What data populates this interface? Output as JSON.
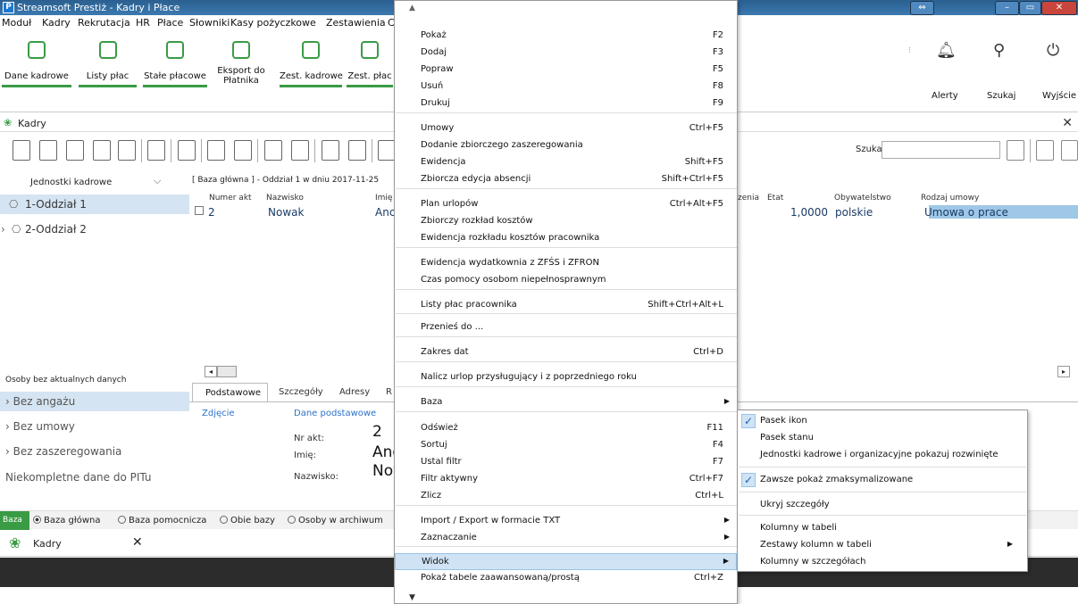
{
  "window": {
    "title": "Streamsoft Prestiż - Kadry i Płace",
    "app_icon": "P"
  },
  "menubar": [
    "Moduł",
    "Kadry",
    "Rekrutacja",
    "HR",
    "Płace",
    "Słowniki",
    "Kasy pożyczkowe",
    "Zestawienia",
    "C"
  ],
  "ribbon": {
    "buttons": [
      "Dane kadrowe",
      "Listy płac",
      "Stałe płacowe",
      "Eksport do Płatnika",
      "Zest. kadrowe",
      "Zest. płac"
    ],
    "right_buttons": [
      "Alerty",
      "Szukaj",
      "Wyjście"
    ]
  },
  "module": {
    "title": "Kadry",
    "search_label": "Szukaj",
    "search_value": ""
  },
  "left_panel": {
    "header": "Jednostki kadrowe",
    "tree": [
      "1-Oddział 1",
      "2-Oddział 2"
    ],
    "section_header": "Osoby bez aktualnych danych",
    "nav": [
      "Bez angażu",
      "Bez umowy",
      "Bez zaszeregowania",
      "Niekompletne dane do PITu"
    ]
  },
  "grid": {
    "caption": "[ Baza główna ] - Oddział 1  w dniu 2017-11-25",
    "columns": [
      "Numer akt",
      "Nazwisko",
      "Imię",
      "zenia",
      "Etat",
      "Obywatelstwo",
      "Rodzaj umowy"
    ],
    "row": [
      "2",
      "Nowak",
      "Anc",
      "1,0000",
      "polskie",
      "Umowa o prace"
    ]
  },
  "detail_tabs": [
    "Podstawowe",
    "Szczegóły",
    "Adresy",
    "R"
  ],
  "details": {
    "photo_link": "Zdjęcie",
    "section_link": "Dane podstawowe",
    "fields": [
      {
        "label": "Nr akt:",
        "value": "2"
      },
      {
        "label": "Imię:",
        "value": "Anc"
      },
      {
        "label": "Nazwisko:",
        "value": "Nov"
      }
    ]
  },
  "statusbar": {
    "label": "Baza",
    "options": [
      "Baza główna",
      "Baza pomocnicza",
      "Obie bazy",
      "Osoby w archiwum"
    ],
    "selected": "Baza główna"
  },
  "taskbar": {
    "tab": "Kadry"
  },
  "context_menu": {
    "items": [
      {
        "label": "Pokaż",
        "shortcut": "F2"
      },
      {
        "label": "Dodaj",
        "shortcut": "F3"
      },
      {
        "label": "Popraw",
        "shortcut": "F5"
      },
      {
        "label": "Usuń",
        "shortcut": "F8"
      },
      {
        "label": "Drukuj",
        "shortcut": "F9"
      },
      {
        "label": "Umowy",
        "shortcut": "Ctrl+F5"
      },
      {
        "label": "Dodanie zbiorczego zaszeregowania",
        "shortcut": ""
      },
      {
        "label": "Ewidencja",
        "shortcut": "Shift+F5"
      },
      {
        "label": "Zbiorcza edycja absencji",
        "shortcut": "Shift+Ctrl+F5"
      },
      {
        "label": "Plan urlopów",
        "shortcut": "Ctrl+Alt+F5"
      },
      {
        "label": "Zbiorczy rozkład kosztów",
        "shortcut": ""
      },
      {
        "label": "Ewidencja rozkładu kosztów pracownika",
        "shortcut": ""
      },
      {
        "label": "Ewidencja wydatkownia z ZFŚS i ZFRON",
        "shortcut": ""
      },
      {
        "label": "Czas pomocy osobom niepełnosprawnym",
        "shortcut": ""
      },
      {
        "label": "Listy płac pracownika",
        "shortcut": "Shift+Ctrl+Alt+L"
      },
      {
        "label": "Przenieś do ...",
        "shortcut": ""
      },
      {
        "label": "Zakres dat",
        "shortcut": "Ctrl+D"
      },
      {
        "label": "Nalicz urlop przysługujący i z poprzedniego roku",
        "shortcut": ""
      },
      {
        "label": "Baza",
        "shortcut": ""
      },
      {
        "label": "Odśwież",
        "shortcut": "F11"
      },
      {
        "label": "Sortuj",
        "shortcut": "F4"
      },
      {
        "label": "Ustal filtr",
        "shortcut": "F7"
      },
      {
        "label": "Filtr aktywny",
        "shortcut": "Ctrl+F7"
      },
      {
        "label": "Zlicz",
        "shortcut": "Ctrl+L"
      },
      {
        "label": "Import / Export w formacie TXT",
        "shortcut": ""
      },
      {
        "label": "Zaznaczanie",
        "shortcut": ""
      },
      {
        "label": "Widok",
        "shortcut": ""
      },
      {
        "label": "Pokaż tabele zaawansowaną/prostą",
        "shortcut": "Ctrl+Z"
      }
    ]
  },
  "submenu": {
    "items": [
      {
        "label": "Pasek ikon",
        "checked": true
      },
      {
        "label": "Pasek stanu",
        "checked": false
      },
      {
        "label": "Jednostki kadrowe i organizacyjne pokazuj rozwinięte",
        "checked": false
      },
      {
        "label": "Zawsze pokaż zmaksymalizowane",
        "checked": true
      },
      {
        "label": "Ukryj szczegóły",
        "checked": false
      },
      {
        "label": "Kolumny w tabeli",
        "checked": false
      },
      {
        "label": "Zestawy kolumn w tabeli",
        "checked": false
      },
      {
        "label": "Kolumny w szczegółach",
        "checked": false
      }
    ]
  }
}
